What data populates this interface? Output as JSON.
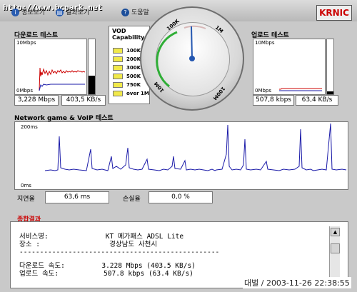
{
  "watermark": "http://www.bcpark.net",
  "menu": {
    "item1": "정보보기",
    "item2": "결과보기",
    "help": "도움말",
    "help_icon": "question-icon"
  },
  "logo": "KRNIC",
  "download": {
    "title": "다운로드 테스트",
    "ymax": "10Mbps",
    "ymin": "0Mbps",
    "mbps": "3,228 Mbps",
    "kbs": "403,5 KB/s"
  },
  "upload": {
    "title": "업로드 테스트",
    "ymax": "10Mbps",
    "ymin": "0Mbps",
    "kbps": "507,8 kbps",
    "kbs": "63,4 KB/s"
  },
  "vod": {
    "title_line1": "VOD",
    "title_line2": "Capability",
    "items": [
      "100K",
      "200K",
      "300K",
      "500K",
      "750K",
      "over 1M"
    ],
    "indicator_color": "#f1e94a"
  },
  "gauge": {
    "labels": [
      "100K",
      "1M",
      "10M",
      "100M"
    ],
    "needle_value": "10M"
  },
  "network": {
    "title": "Network game & VoIP 테스트",
    "ymax": "200ms",
    "ymin": "0ms",
    "latency_label": "지연율",
    "latency_value": "63,6 ms",
    "loss_label": "손실율",
    "loss_value": "0,0 %"
  },
  "result": {
    "title": "종합결과",
    "lines": [
      "서비스명:              KT 메가패스 ADSL Lite",
      "장소 :                 경상남도 사천시",
      "-------------------------------------------------",
      "다운로드 속도:         3.228 Mbps (403.5 KB/s)",
      "업로드 속도:           507.8 kbps (63.4 KB/s)"
    ]
  },
  "timestamp": "대벌 / 2003-11-26 22:38:55",
  "colors": {
    "download_line": "#cc0000",
    "network_line": "#1a1aa8",
    "result_title": "#cc0000"
  }
}
